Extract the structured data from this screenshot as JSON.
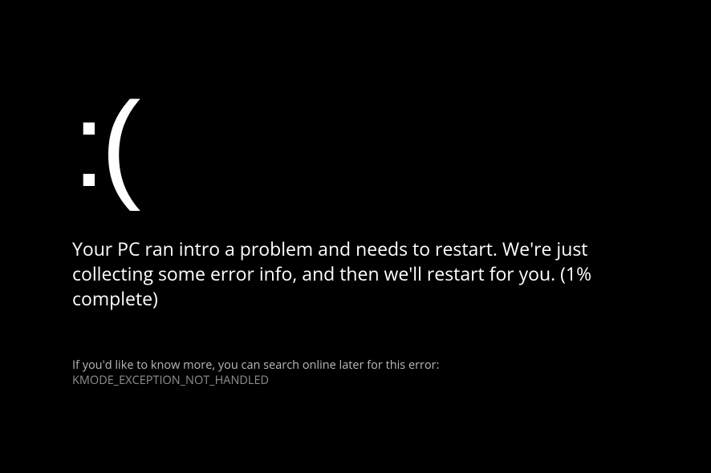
{
  "sad_face": ":(",
  "main_message": "Your PC ran intro a problem and needs to restart. We're just collecting some error info, and then we'll restart for you. (1% complete)",
  "info_prefix": "If you'd like to know more, you can search online later for this error: ",
  "error_code": "KMODE_EXCEPTION_NOT_HANDLED"
}
